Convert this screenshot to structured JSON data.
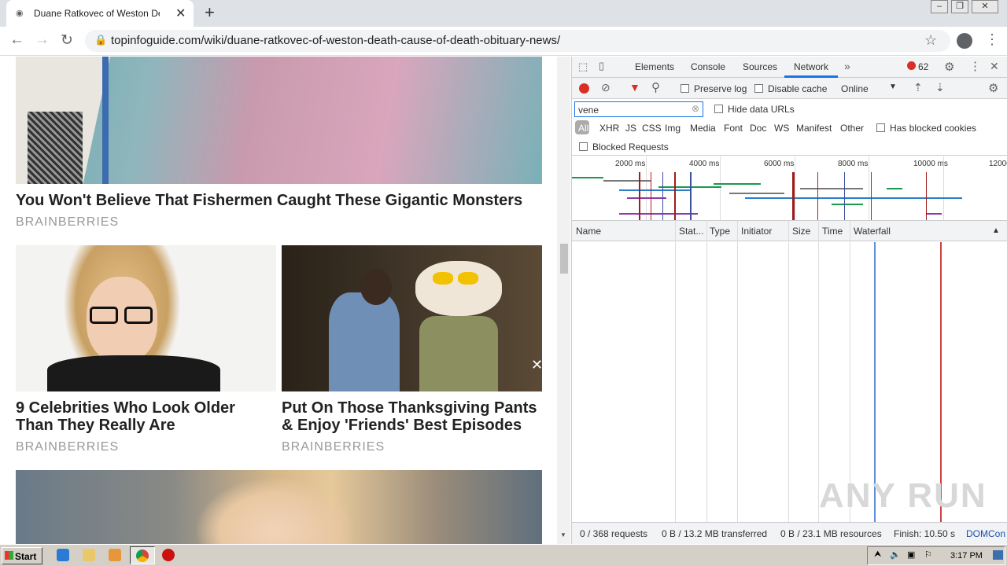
{
  "browser": {
    "tab_title": "Duane Ratkovec of Weston Death –",
    "url": "topinfoguide.com/wiki/duane-ratkovec-of-weston-death-cause-of-death-obituary-news/"
  },
  "articles": [
    {
      "headline": "You Won't Believe That Fishermen Caught These Gigantic Monsters",
      "source": "BRAINBERRIES"
    },
    {
      "headline": "9 Celebrities Who Look Older Than They Really Are",
      "source": "BRAINBERRIES"
    },
    {
      "headline": "Put On Those Thanksgiving Pants & Enjoy 'Friends' Best Episodes",
      "source": "BRAINBERRIES"
    }
  ],
  "devtools": {
    "tabs": [
      "Elements",
      "Console",
      "Sources",
      "Network"
    ],
    "error_count": "62",
    "preserve_log": "Preserve log",
    "disable_cache": "Disable cache",
    "throttle": "Online",
    "filter_value": "vene",
    "hide_data_urls": "Hide data URLs",
    "type_filters": [
      "All",
      "XHR",
      "JS",
      "CSS",
      "Img",
      "Media",
      "Font",
      "Doc",
      "WS",
      "Manifest",
      "Other"
    ],
    "has_blocked_cookies": "Has blocked cookies",
    "blocked_requests": "Blocked Requests",
    "timeline_ticks": [
      "2000 ms",
      "4000 ms",
      "6000 ms",
      "8000 ms",
      "10000 ms",
      "12000"
    ],
    "columns": [
      "Name",
      "Stat...",
      "Type",
      "Initiator",
      "Size",
      "Time",
      "Waterfall"
    ],
    "status": {
      "requests": "0 / 368 requests",
      "transferred": "0 B / 13.2 MB transferred",
      "resources": "0 B / 23.1 MB resources",
      "finish": "Finish: 10.50 s",
      "domcon": "DOMCon"
    }
  },
  "taskbar": {
    "start": "Start",
    "clock": "3:17 PM"
  },
  "watermark": "ANY RUN"
}
